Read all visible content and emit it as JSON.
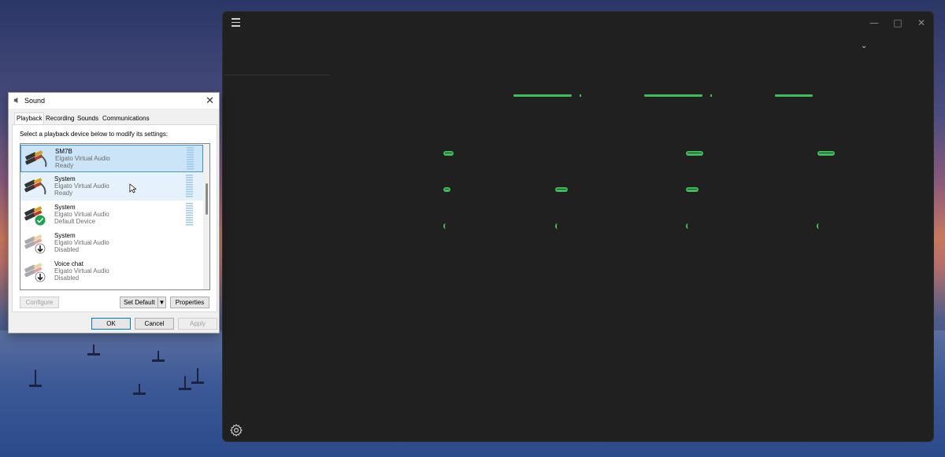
{
  "dialog": {
    "title": "Sound",
    "tabs": [
      "Playback",
      "Recording",
      "Sounds",
      "Communications"
    ],
    "active_tab": "Playback",
    "instruction": "Select a playback device below to modify its settings:",
    "devices": [
      {
        "name": "SM7B",
        "driver": "Elgato Virtual Audio",
        "status": "Ready",
        "state": "selected",
        "icon": "speaker-cable-icon"
      },
      {
        "name": "System",
        "driver": "Elgato Virtual Audio",
        "status": "Ready",
        "state": "hover",
        "icon": "speaker-cable-icon"
      },
      {
        "name": "System",
        "driver": "Elgato Virtual Audio",
        "status": "Default Device",
        "state": "default",
        "icon": "speaker-cable-default-icon"
      },
      {
        "name": "System",
        "driver": "Elgato Virtual Audio",
        "status": "Disabled",
        "state": "disabled",
        "icon": "speaker-cable-disabled-icon"
      },
      {
        "name": "Voice chat",
        "driver": "Elgato Virtual Audio",
        "status": "Disabled",
        "state": "disabled",
        "icon": "speaker-cable-disabled-icon"
      }
    ],
    "buttons": {
      "configure": "Configure",
      "set_default": "Set Default",
      "properties": "Properties",
      "ok": "OK",
      "cancel": "Cancel",
      "apply": "Apply"
    }
  },
  "colors": {
    "accent_green": "#3cbf5a",
    "selection": "#cce4f7",
    "selection_border": "#3a8ee6",
    "dark_window": "#202020"
  }
}
